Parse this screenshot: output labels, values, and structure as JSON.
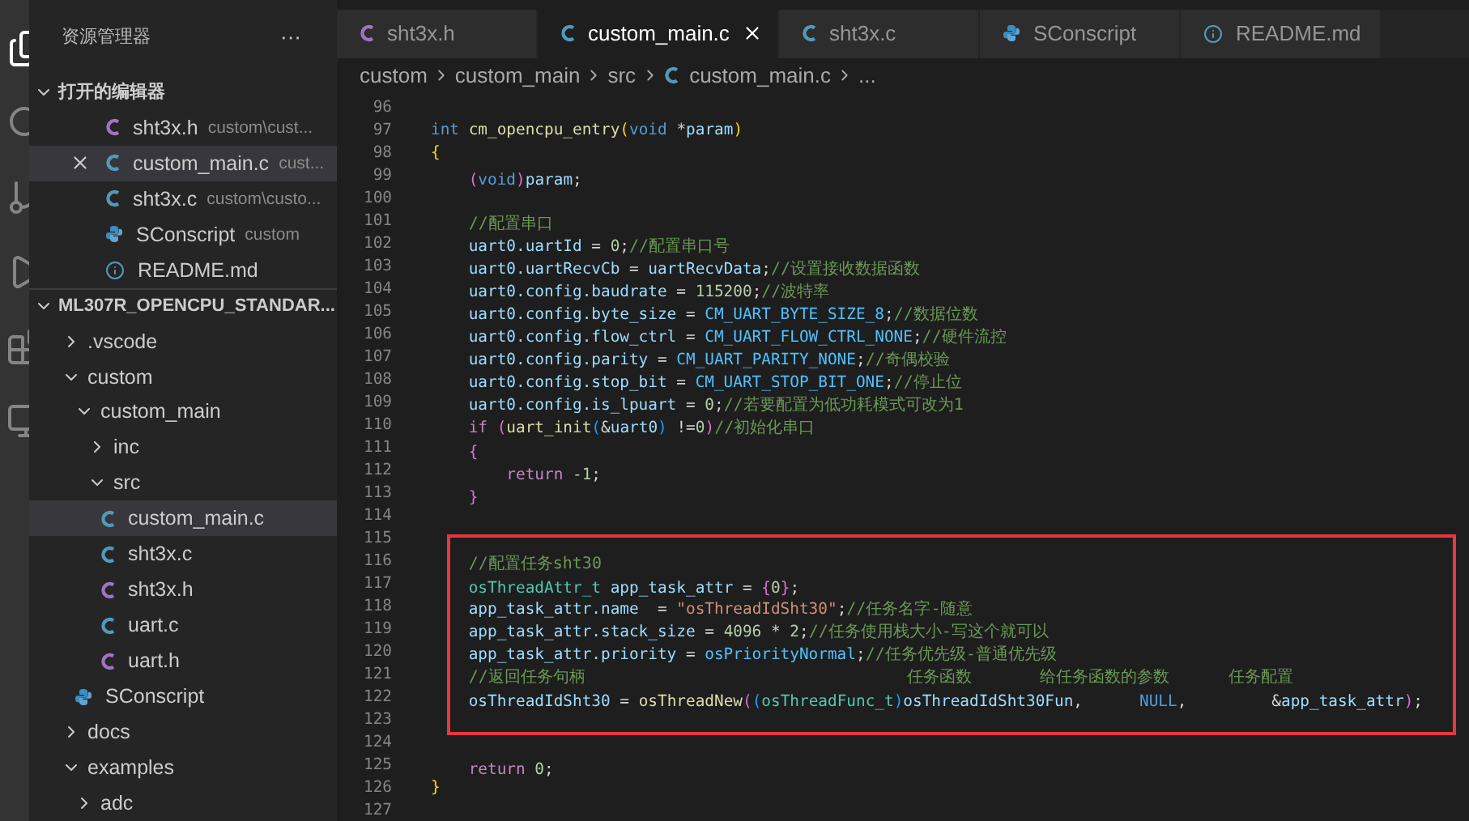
{
  "sidebar": {
    "title": "资源管理器",
    "more": "···",
    "open_editors": {
      "title": "打开的编辑器",
      "expanded": true,
      "items": [
        {
          "name": "sht3x.h",
          "path": "custom\\cust...",
          "kind": "h",
          "selected": false
        },
        {
          "name": "custom_main.c",
          "path": "cust...",
          "kind": "c",
          "selected": true
        },
        {
          "name": "sht3x.c",
          "path": "custom\\custo...",
          "kind": "c",
          "selected": false
        },
        {
          "name": "SConscript",
          "path": "custom",
          "kind": "python",
          "selected": false
        },
        {
          "name": "README.md",
          "kind": "info",
          "selected": false
        }
      ]
    },
    "project": {
      "title": "ML307R_OPENCPU_STANDAR...",
      "expanded": true,
      "tree": [
        {
          "name": ".vscode",
          "kind": "folder",
          "expanded": false,
          "selected": false
        },
        {
          "name": "custom",
          "kind": "folder",
          "expanded": true,
          "selected": false,
          "children": [
            {
              "name": "custom_main",
              "kind": "folder",
              "expanded": true,
              "selected": false,
              "children": [
                {
                  "name": "inc",
                  "kind": "folder",
                  "expanded": false,
                  "selected": false
                },
                {
                  "name": "src",
                  "kind": "folder",
                  "expanded": true,
                  "selected": false,
                  "children": [
                    {
                      "name": "custom_main.c",
                      "kind": "c",
                      "selected": true
                    },
                    {
                      "name": "sht3x.c",
                      "kind": "c",
                      "selected": false
                    },
                    {
                      "name": "sht3x.h",
                      "kind": "h",
                      "selected": false
                    },
                    {
                      "name": "uart.c",
                      "kind": "c",
                      "selected": false
                    },
                    {
                      "name": "uart.h",
                      "kind": "h",
                      "selected": false
                    }
                  ]
                }
              ]
            },
            {
              "name": "SConscript",
              "kind": "python",
              "selected": false
            }
          ]
        },
        {
          "name": "docs",
          "kind": "folder",
          "expanded": false,
          "selected": false
        },
        {
          "name": "examples",
          "kind": "folder",
          "expanded": true,
          "selected": false,
          "children": [
            {
              "name": "adc",
              "kind": "folder",
              "expanded": false,
              "selected": false
            }
          ]
        }
      ]
    }
  },
  "tabs": [
    {
      "label": "sht3x.h",
      "kind": "h",
      "selected": false
    },
    {
      "label": "custom_main.c",
      "kind": "c",
      "selected": true
    },
    {
      "label": "sht3x.c",
      "kind": "c",
      "selected": false
    },
    {
      "label": "SConscript",
      "kind": "python",
      "selected": false
    },
    {
      "label": "README.md",
      "kind": "info",
      "selected": false
    }
  ],
  "breadcrumb": [
    {
      "label": "custom",
      "kind": "text"
    },
    {
      "label": "custom_main",
      "kind": "text"
    },
    {
      "label": "src",
      "kind": "text"
    },
    {
      "label": "custom_main.c",
      "kind": "c"
    },
    {
      "label": "...",
      "kind": "text"
    }
  ],
  "code": {
    "lines_before": [
      {
        "no": "96"
      },
      {
        "no": "97",
        "tokens": [
          {
            "kind": "kw",
            "text": "int "
          },
          {
            "kind": "fn",
            "text": "cm_opencpu_entry"
          },
          {
            "kind": "b1",
            "text": "("
          },
          {
            "kind": "kw",
            "text": "void"
          },
          {
            "kind": "p",
            "text": " *"
          },
          {
            "kind": "var",
            "text": "param"
          },
          {
            "kind": "b1",
            "text": ")"
          }
        ]
      },
      {
        "no": "98",
        "tokens": [
          {
            "kind": "b1",
            "text": "{"
          }
        ]
      },
      {
        "no": "99",
        "tokens": [
          {
            "kind": "indent"
          },
          {
            "kind": "b2",
            "text": "("
          },
          {
            "kind": "kw",
            "text": "void"
          },
          {
            "kind": "b2",
            "text": ")"
          },
          {
            "kind": "var",
            "text": "param"
          },
          {
            "kind": "p",
            "text": ";"
          }
        ]
      },
      {
        "no": "100"
      },
      {
        "no": "101",
        "tokens": [
          {
            "kind": "indent"
          },
          {
            "kind": "cm",
            "text": "//配置串口"
          }
        ]
      },
      {
        "no": "102",
        "tokens": [
          {
            "kind": "indent"
          },
          {
            "kind": "var",
            "text": "uart0.uartId"
          },
          {
            "kind": "p",
            "text": " = "
          },
          {
            "kind": "num",
            "text": "0"
          },
          {
            "kind": "p",
            "text": ";"
          },
          {
            "kind": "cm",
            "text": "//配置串口号"
          }
        ]
      },
      {
        "no": "103",
        "tokens": [
          {
            "kind": "indent"
          },
          {
            "kind": "var",
            "text": "uart0.uartRecvCb"
          },
          {
            "kind": "p",
            "text": " = "
          },
          {
            "kind": "var",
            "text": "uartRecvData"
          },
          {
            "kind": "p",
            "text": ";"
          },
          {
            "kind": "cm",
            "text": "//设置接收数据函数"
          }
        ]
      },
      {
        "no": "104",
        "tokens": [
          {
            "kind": "indent"
          },
          {
            "kind": "var",
            "text": "uart0.config.baudrate"
          },
          {
            "kind": "p",
            "text": " = "
          },
          {
            "kind": "num",
            "text": "115200"
          },
          {
            "kind": "p",
            "text": ";"
          },
          {
            "kind": "cm",
            "text": "//波特率"
          }
        ]
      },
      {
        "no": "105",
        "tokens": [
          {
            "kind": "indent"
          },
          {
            "kind": "var",
            "text": "uart0.config.byte_size"
          },
          {
            "kind": "p",
            "text": " = "
          },
          {
            "kind": "const",
            "text": "CM_UART_BYTE_SIZE_8"
          },
          {
            "kind": "p",
            "text": ";"
          },
          {
            "kind": "cm",
            "text": "//数据位数"
          }
        ]
      },
      {
        "no": "106",
        "tokens": [
          {
            "kind": "indent"
          },
          {
            "kind": "var",
            "text": "uart0.config.flow_ctrl"
          },
          {
            "kind": "p",
            "text": " = "
          },
          {
            "kind": "const",
            "text": "CM_UART_FLOW_CTRL_NONE"
          },
          {
            "kind": "p",
            "text": ";"
          },
          {
            "kind": "cm",
            "text": "//硬件流控"
          }
        ]
      },
      {
        "no": "107",
        "tokens": [
          {
            "kind": "indent"
          },
          {
            "kind": "var",
            "text": "uart0.config.parity"
          },
          {
            "kind": "p",
            "text": " = "
          },
          {
            "kind": "const",
            "text": "CM_UART_PARITY_NONE"
          },
          {
            "kind": "p",
            "text": ";"
          },
          {
            "kind": "cm",
            "text": "//奇偶校验"
          }
        ]
      },
      {
        "no": "108",
        "tokens": [
          {
            "kind": "indent"
          },
          {
            "kind": "var",
            "text": "uart0.config.stop_bit"
          },
          {
            "kind": "p",
            "text": " = "
          },
          {
            "kind": "const",
            "text": "CM_UART_STOP_BIT_ONE"
          },
          {
            "kind": "p",
            "text": ";"
          },
          {
            "kind": "cm",
            "text": "//停止位"
          }
        ]
      },
      {
        "no": "109",
        "tokens": [
          {
            "kind": "indent"
          },
          {
            "kind": "var",
            "text": "uart0.config.is_lpuart"
          },
          {
            "kind": "p",
            "text": " = "
          },
          {
            "kind": "num",
            "text": "0"
          },
          {
            "kind": "p",
            "text": ";"
          },
          {
            "kind": "cm",
            "text": "//若要配置为低功耗模式可改为1"
          }
        ]
      },
      {
        "no": "110",
        "tokens": [
          {
            "kind": "indent"
          },
          {
            "kind": "ctl",
            "text": "if "
          },
          {
            "kind": "b2",
            "text": "("
          },
          {
            "kind": "fn",
            "text": "uart_init"
          },
          {
            "kind": "b3",
            "text": "("
          },
          {
            "kind": "p",
            "text": "&"
          },
          {
            "kind": "var",
            "text": "uart0"
          },
          {
            "kind": "b3",
            "text": ")"
          },
          {
            "kind": "p",
            "text": " !="
          },
          {
            "kind": "num",
            "text": "0"
          },
          {
            "kind": "b2",
            "text": ")"
          },
          {
            "kind": "cm",
            "text": "//初始化串口"
          }
        ]
      },
      {
        "no": "111",
        "tokens": [
          {
            "kind": "indent"
          },
          {
            "kind": "b2",
            "text": "{"
          }
        ]
      },
      {
        "no": "112",
        "tokens": [
          {
            "kind": "indent"
          },
          {
            "kind": "indent"
          },
          {
            "kind": "ctl",
            "text": "return "
          },
          {
            "kind": "num",
            "text": "-1"
          },
          {
            "kind": "p",
            "text": ";"
          }
        ]
      },
      {
        "no": "113",
        "tokens": [
          {
            "kind": "indent"
          },
          {
            "kind": "b2",
            "text": "}"
          }
        ]
      },
      {
        "no": "114"
      },
      {
        "no": "115"
      }
    ],
    "highlighted_lines": [
      {
        "no": "116",
        "tokens": [
          {
            "kind": "indent"
          },
          {
            "kind": "cm",
            "text": "//配置任务sht30"
          }
        ]
      },
      {
        "no": "117",
        "tokens": [
          {
            "kind": "indent"
          },
          {
            "kind": "type",
            "text": "osThreadAttr_t "
          },
          {
            "kind": "var",
            "text": "app_task_attr"
          },
          {
            "kind": "p",
            "text": " = "
          },
          {
            "kind": "b2",
            "text": "{"
          },
          {
            "kind": "num",
            "text": "0"
          },
          {
            "kind": "b2",
            "text": "}"
          },
          {
            "kind": "p",
            "text": ";"
          }
        ]
      },
      {
        "no": "118",
        "tokens": [
          {
            "kind": "indent"
          },
          {
            "kind": "var",
            "text": "app_task_attr.name"
          },
          {
            "kind": "p",
            "text": "  = "
          },
          {
            "kind": "str",
            "text": "\"osThreadIdSht30\""
          },
          {
            "kind": "p",
            "text": ";"
          },
          {
            "kind": "cm",
            "text": "//任务名字-随意"
          }
        ]
      },
      {
        "no": "119",
        "tokens": [
          {
            "kind": "indent"
          },
          {
            "kind": "var",
            "text": "app_task_attr.stack_size"
          },
          {
            "kind": "p",
            "text": " = "
          },
          {
            "kind": "num",
            "text": "4096"
          },
          {
            "kind": "p",
            "text": " * "
          },
          {
            "kind": "num",
            "text": "2"
          },
          {
            "kind": "p",
            "text": ";"
          },
          {
            "kind": "cm",
            "text": "//任务使用栈大小-写这个就可以"
          }
        ]
      },
      {
        "no": "120",
        "tokens": [
          {
            "kind": "indent"
          },
          {
            "kind": "var",
            "text": "app_task_attr.priority"
          },
          {
            "kind": "p",
            "text": " = "
          },
          {
            "kind": "const",
            "text": "osPriorityNormal"
          },
          {
            "kind": "p",
            "text": ";"
          },
          {
            "kind": "cm",
            "text": "//任务优先级-普通优先级"
          }
        ]
      },
      {
        "no": "121",
        "tokens": [
          {
            "kind": "indent"
          },
          {
            "kind": "cm",
            "text": "//返回任务句柄                                 任务函数       给任务函数的参数      任务配置"
          }
        ]
      },
      {
        "no": "122",
        "tokens": [
          {
            "kind": "indent"
          },
          {
            "kind": "var",
            "text": "osThreadIdSht30"
          },
          {
            "kind": "p",
            "text": " = "
          },
          {
            "kind": "fn",
            "text": "osThreadNew"
          },
          {
            "kind": "b2",
            "text": "("
          },
          {
            "kind": "b3",
            "text": "("
          },
          {
            "kind": "type",
            "text": "osThreadFunc_t"
          },
          {
            "kind": "b3",
            "text": ")"
          },
          {
            "kind": "var",
            "text": "osThreadIdSht30Fun"
          },
          {
            "kind": "p",
            "text": ",      "
          },
          {
            "kind": "kw",
            "text": "NULL"
          },
          {
            "kind": "p",
            "text": ",         &"
          },
          {
            "kind": "var",
            "text": "app_task_attr"
          },
          {
            "kind": "b2",
            "text": ")"
          },
          {
            "kind": "p",
            "text": ";"
          }
        ]
      },
      {
        "no": "123"
      }
    ],
    "lines_after": [
      {
        "no": "124"
      },
      {
        "no": "125",
        "tokens": [
          {
            "kind": "indent"
          },
          {
            "kind": "ctl",
            "text": "return "
          },
          {
            "kind": "num",
            "text": "0"
          },
          {
            "kind": "p",
            "text": ";"
          }
        ]
      },
      {
        "no": "126",
        "tokens": [
          {
            "kind": "b1",
            "text": "}"
          }
        ]
      },
      {
        "no": "127"
      }
    ]
  }
}
